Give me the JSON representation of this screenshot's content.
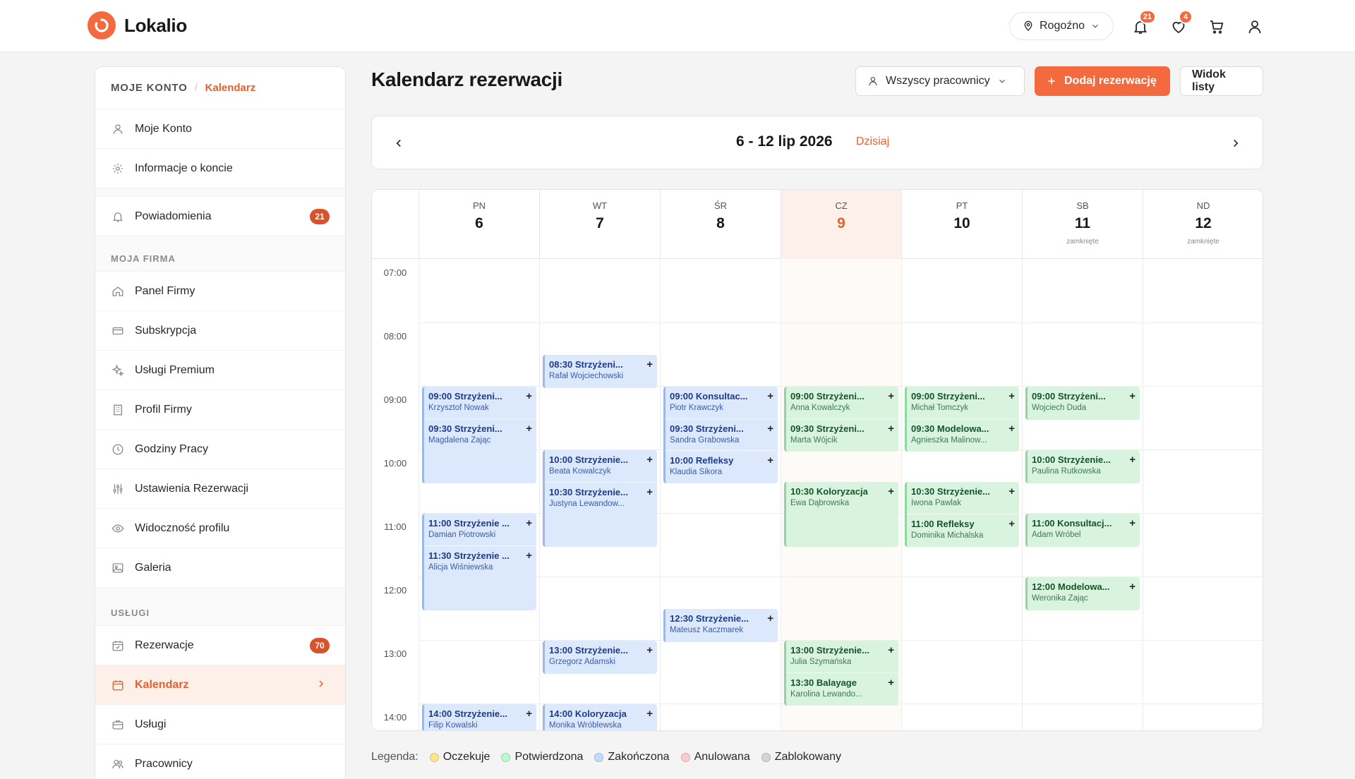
{
  "header": {
    "brand": "Lokalio",
    "location": "Rogoźno",
    "notifications_count": "21",
    "favorites_count": "4",
    "accent_color": "#f26a3d"
  },
  "sidebar": {
    "breadcrumb_root": "MOJE KONTO",
    "breadcrumb_sep": "/",
    "breadcrumb_current": "Kalendarz",
    "account_items": [
      {
        "label": "Moje Konto",
        "icon": "user-icon"
      },
      {
        "label": "Informacje o koncie",
        "icon": "gear-icon"
      }
    ],
    "notifications": {
      "label": "Powiadomienia",
      "badge": "21",
      "icon": "bell-icon"
    },
    "section_company": "MOJA FIRMA",
    "company_items": [
      {
        "label": "Panel Firmy",
        "icon": "home-icon"
      },
      {
        "label": "Subskrypcja",
        "icon": "card-icon"
      },
      {
        "label": "Usługi Premium",
        "icon": "sparkle-icon"
      },
      {
        "label": "Profil Firmy",
        "icon": "building-icon"
      },
      {
        "label": "Godziny Pracy",
        "icon": "clock-icon"
      },
      {
        "label": "Ustawienia Rezerwacji",
        "icon": "sliders-icon"
      },
      {
        "label": "Widoczność profilu",
        "icon": "eye-icon"
      },
      {
        "label": "Galeria",
        "icon": "image-icon"
      }
    ],
    "section_services": "USŁUGI",
    "service_items": [
      {
        "label": "Rezerwacje",
        "badge": "70",
        "icon": "calendar-check-icon"
      },
      {
        "label": "Kalendarz",
        "icon": "calendar-icon",
        "active": true
      },
      {
        "label": "Usługi",
        "icon": "briefcase-icon"
      },
      {
        "label": "Pracownicy",
        "icon": "users-icon"
      }
    ]
  },
  "main": {
    "title": "Kalendarz rezerwacji",
    "employee_filter": "Wszyscy pracownicy",
    "add_button": "Dodaj rezerwację",
    "list_view_button": "Widok listy",
    "week_label": "6 - 12 lip 2026",
    "today_link": "Dzisiaj"
  },
  "calendar": {
    "days": [
      {
        "abbr": "PN",
        "num": "6",
        "closed": ""
      },
      {
        "abbr": "WT",
        "num": "7",
        "closed": ""
      },
      {
        "abbr": "ŚR",
        "num": "8",
        "closed": ""
      },
      {
        "abbr": "CZ",
        "num": "9",
        "closed": "",
        "today": true
      },
      {
        "abbr": "PT",
        "num": "10",
        "closed": ""
      },
      {
        "abbr": "SB",
        "num": "11",
        "closed": "zamknięte"
      },
      {
        "abbr": "ND",
        "num": "12",
        "closed": "zamknięte"
      }
    ],
    "hours": [
      "07:00",
      "08:00",
      "09:00",
      "10:00",
      "11:00",
      "12:00",
      "13:00",
      "14:00"
    ],
    "appointments": [
      {
        "day": 0,
        "start": 9.0,
        "slots": 3,
        "status": "completed",
        "rows": [
          {
            "title": "09:00 Strzyżeni...",
            "client": "Krzysztof Nowak"
          },
          {
            "title": "09:30 Strzyżeni...",
            "client": "Magdalena Zając"
          }
        ]
      },
      {
        "day": 0,
        "start": 11.0,
        "slots": 3,
        "status": "completed",
        "rows": [
          {
            "title": "11:00 Strzyżenie ...",
            "client": "Damian Piotrowski"
          },
          {
            "title": "11:30 Strzyżenie ...",
            "client": "Alicja Wiśniewska"
          }
        ]
      },
      {
        "day": 0,
        "start": 14.0,
        "slots": 1,
        "status": "completed",
        "rows": [
          {
            "title": "14:00 Strzyżenie...",
            "client": "Filip Kowalski"
          }
        ]
      },
      {
        "day": 1,
        "start": 8.5,
        "slots": 1,
        "status": "completed",
        "rows": [
          {
            "title": "08:30 Strzyżeni...",
            "client": "Rafał Wojciechowski"
          }
        ]
      },
      {
        "day": 1,
        "start": 10.0,
        "slots": 3,
        "status": "completed",
        "rows": [
          {
            "title": "10:00 Strzyżenie...",
            "client": "Beata Kowalczyk"
          },
          {
            "title": "10:30 Strzyżenie...",
            "client": "Justyna Lewandow..."
          }
        ]
      },
      {
        "day": 1,
        "start": 13.0,
        "slots": 1,
        "status": "completed",
        "rows": [
          {
            "title": "13:00 Strzyżenie...",
            "client": "Grzegorz Adamski"
          }
        ]
      },
      {
        "day": 1,
        "start": 14.0,
        "slots": 1,
        "status": "completed",
        "rows": [
          {
            "title": "14:00 Koloryzacja",
            "client": "Monika Wróblewska"
          }
        ]
      },
      {
        "day": 2,
        "start": 9.0,
        "slots": 3,
        "status": "completed",
        "rows": [
          {
            "title": "09:00 Konsultac...",
            "client": "Piotr Krawczyk"
          },
          {
            "title": "09:30 Strzyżeni...",
            "client": "Sandra Grabowska"
          },
          {
            "title": "10:00 Refleksy",
            "client": "Klaudia Sikora"
          }
        ]
      },
      {
        "day": 2,
        "start": 12.5,
        "slots": 1,
        "status": "completed",
        "rows": [
          {
            "title": "12:30 Strzyżenie...",
            "client": "Mateusz Kaczmarek"
          }
        ]
      },
      {
        "day": 3,
        "start": 9.0,
        "slots": 2,
        "status": "confirmed",
        "rows": [
          {
            "title": "09:00 Strzyżeni...",
            "client": "Anna Kowalczyk"
          },
          {
            "title": "09:30 Strzyżeni...",
            "client": "Marta Wójcik"
          }
        ]
      },
      {
        "day": 3,
        "start": 10.5,
        "slots": 2,
        "status": "confirmed",
        "rows": [
          {
            "title": "10:30 Koloryzacja",
            "client": "Ewa Dąbrowska"
          }
        ]
      },
      {
        "day": 3,
        "start": 13.0,
        "slots": 2,
        "status": "confirmed",
        "rows": [
          {
            "title": "13:00 Strzyżenie...",
            "client": "Julia Szymańska"
          },
          {
            "title": "13:30 Balayage",
            "client": "Karolina Lewando..."
          }
        ]
      },
      {
        "day": 4,
        "start": 9.0,
        "slots": 2,
        "status": "confirmed",
        "rows": [
          {
            "title": "09:00 Strzyżeni...",
            "client": "Michał Tomczyk"
          },
          {
            "title": "09:30 Modelowa...",
            "client": "Agnieszka Malinow..."
          }
        ]
      },
      {
        "day": 4,
        "start": 10.5,
        "slots": 2,
        "status": "confirmed",
        "rows": [
          {
            "title": "10:30 Strzyżenie...",
            "client": "Iwona Pawlak"
          },
          {
            "title": "11:00 Refleksy",
            "client": "Dominika Michalska"
          }
        ]
      },
      {
        "day": 5,
        "start": 9.0,
        "slots": 1,
        "status": "confirmed",
        "rows": [
          {
            "title": "09:00 Strzyżeni...",
            "client": "Wojciech Duda"
          }
        ]
      },
      {
        "day": 5,
        "start": 10.0,
        "slots": 1,
        "status": "confirmed",
        "rows": [
          {
            "title": "10:00 Strzyżenie...",
            "client": "Paulina Rutkowska"
          }
        ]
      },
      {
        "day": 5,
        "start": 11.0,
        "slots": 1,
        "status": "confirmed",
        "rows": [
          {
            "title": "11:00 Konsultacj...",
            "client": "Adam Wróbel"
          }
        ]
      },
      {
        "day": 5,
        "start": 12.0,
        "slots": 1,
        "status": "confirmed",
        "rows": [
          {
            "title": "12:00 Modelowa...",
            "client": "Weronika Zając"
          }
        ]
      }
    ]
  },
  "legend": {
    "title": "Legenda:",
    "items": [
      {
        "label": "Oczekuje",
        "color": "#fde68a"
      },
      {
        "label": "Potwierdzona",
        "color": "#bbf7d0"
      },
      {
        "label": "Zakończona",
        "color": "#bfdbfe"
      },
      {
        "label": "Anulowana",
        "color": "#fecaca"
      },
      {
        "label": "Zablokowany",
        "color": "#d4d4d8"
      }
    ]
  }
}
